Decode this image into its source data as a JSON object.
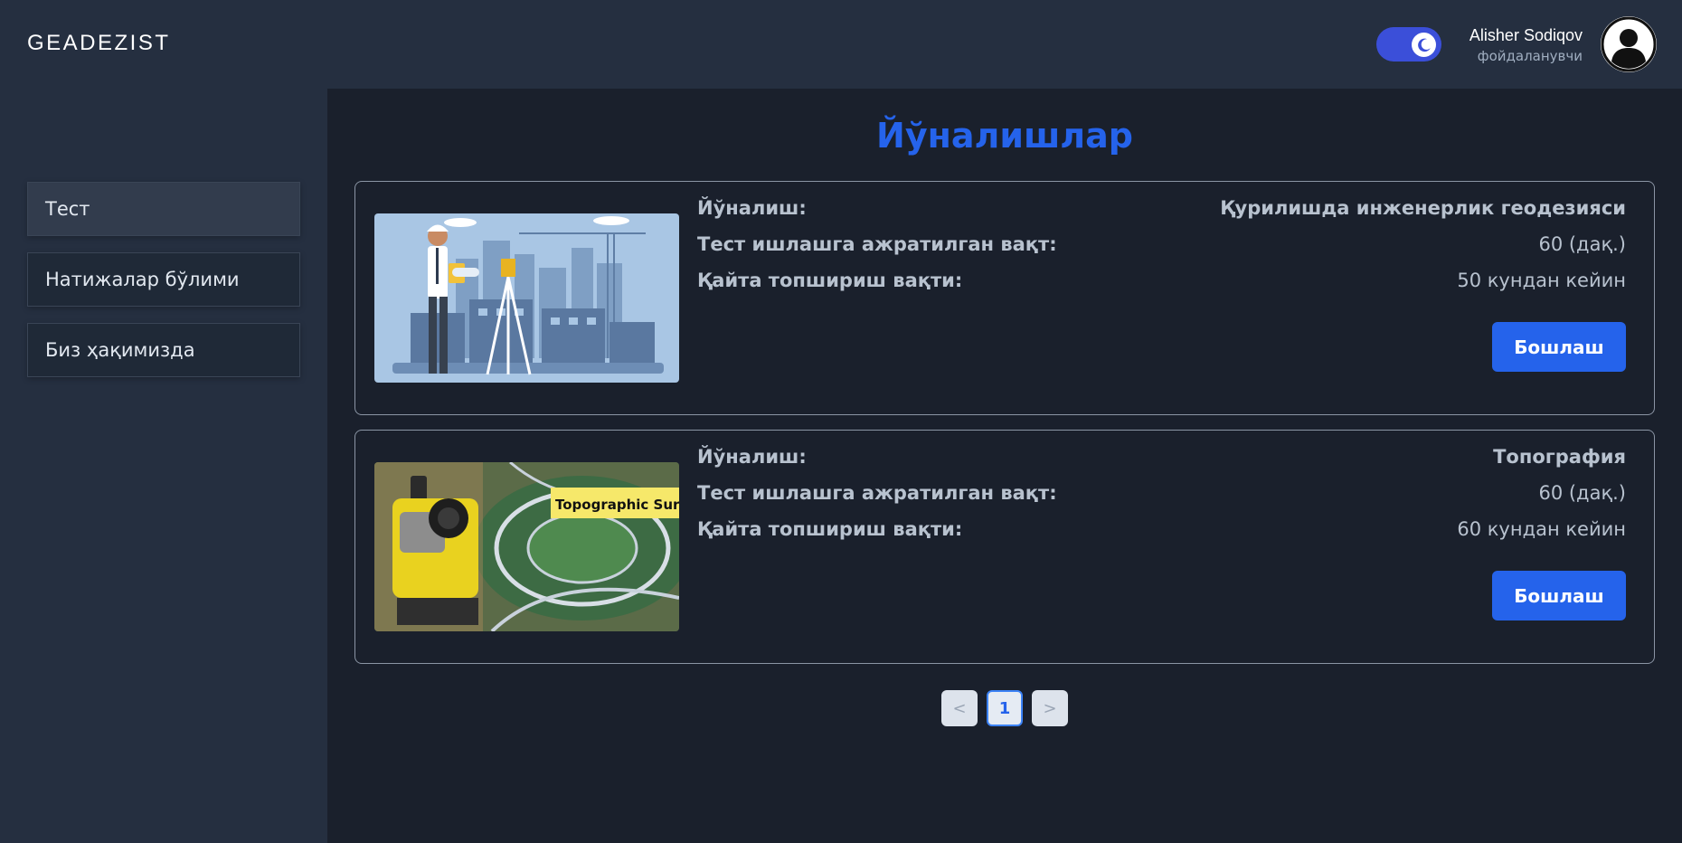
{
  "header": {
    "logo": "GEADEZIST",
    "theme_toggle": {
      "state": "dark",
      "icon": "moon-icon"
    },
    "user": {
      "name": "Alisher Sodiqov",
      "role": "фойдаланувчи",
      "avatar_icon": "user-avatar-icon"
    }
  },
  "sidebar": {
    "items": [
      {
        "label": "Тест",
        "active": true
      },
      {
        "label": "Натижалар бўлими",
        "active": false
      },
      {
        "label": "Биз ҳақимизда",
        "active": false
      }
    ]
  },
  "main": {
    "title": "Йўналишлар",
    "labels": {
      "direction": "Йўналиш:",
      "time": "Тест ишлашга ажратилган вақт:",
      "retake": "Қайта топшириш вақти:"
    },
    "cards": [
      {
        "direction": "Қурилишда инженерлик геодезияси",
        "time": "60 (дақ.)",
        "retake": "50 кундан кейин",
        "button": "Бошлаш",
        "image": "construction-surveyor-illustration"
      },
      {
        "direction": "Топография",
        "time": "60 (дақ.)",
        "retake": "60 кундан кейин",
        "button": "Бошлаш",
        "image": "topographic-survey-photo",
        "image_banner": "Topographic Surve"
      }
    ]
  },
  "pagination": {
    "prev": "<",
    "current": "1",
    "next": ">"
  },
  "colors": {
    "accent": "#2563eb",
    "background": "#1a202c",
    "panel": "#252f40",
    "toggle": "#3b4fd9"
  }
}
